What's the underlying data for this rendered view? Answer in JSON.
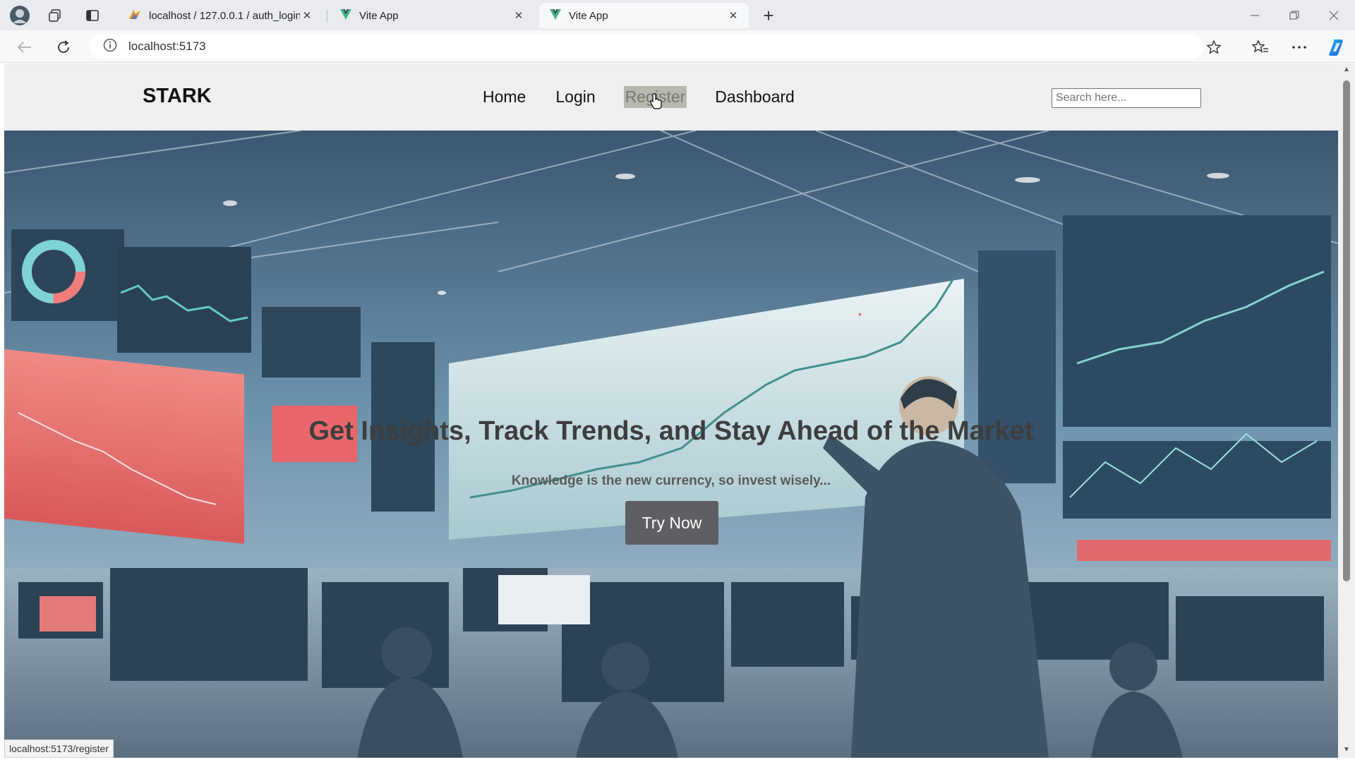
{
  "browser": {
    "tabs": [
      {
        "title": "localhost / 127.0.0.1 / auth_login",
        "icon": "phpmyadmin-icon",
        "active": false
      },
      {
        "title": "Vite App",
        "icon": "vite-icon",
        "active": false
      },
      {
        "title": "Vite App",
        "icon": "vite-icon",
        "active": true
      }
    ],
    "address": "localhost:5173",
    "status_url": "localhost:5173/register"
  },
  "site": {
    "brand": "STARK",
    "nav": [
      {
        "label": "Home"
      },
      {
        "label": "Login"
      },
      {
        "label": "Register",
        "hovered": true
      },
      {
        "label": "Dashboard"
      }
    ],
    "search_placeholder": "Search here..."
  },
  "hero": {
    "title": "Get Insights, Track Trends, and Stay Ahead of the Market",
    "subtitle": "Knowledge is the new currency, so invest wisely...",
    "cta_label": "Try Now"
  },
  "colors": {
    "accent_blue": "#1a73e8",
    "nav_bg": "#efefef",
    "hover_highlight": "#b9b8ae",
    "cta_bg": "#5d5f62"
  }
}
